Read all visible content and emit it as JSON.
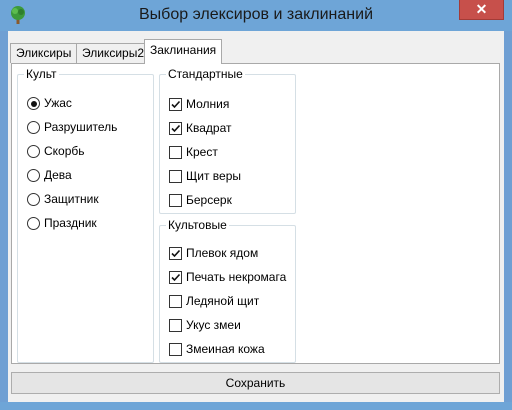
{
  "window": {
    "title": "Выбор элексиров и заклинаний",
    "close_symbol": "✕"
  },
  "tabs": [
    {
      "label": "Эликсиры",
      "active": false
    },
    {
      "label": "Эликсиры2",
      "active": false
    },
    {
      "label": "Заклинания",
      "active": true
    }
  ],
  "cult": {
    "legend": "Культ",
    "options": [
      {
        "label": "Ужас",
        "selected": true
      },
      {
        "label": "Разрушитель",
        "selected": false
      },
      {
        "label": "Скорбь",
        "selected": false
      },
      {
        "label": "Дева",
        "selected": false
      },
      {
        "label": "Защитник",
        "selected": false
      },
      {
        "label": "Праздник",
        "selected": false
      }
    ]
  },
  "standard": {
    "legend": "Стандартные",
    "items": [
      {
        "label": "Молния",
        "checked": true
      },
      {
        "label": "Квадрат",
        "checked": true
      },
      {
        "label": "Крест",
        "checked": false
      },
      {
        "label": "Щит веры",
        "checked": false
      },
      {
        "label": "Берсерк",
        "checked": false
      }
    ]
  },
  "cultish": {
    "legend": "Культовые",
    "items": [
      {
        "label": "Плевок ядом",
        "checked": true
      },
      {
        "label": "Печать некромага",
        "checked": true
      },
      {
        "label": "Ледяной щит",
        "checked": false
      },
      {
        "label": "Укус змеи",
        "checked": false
      },
      {
        "label": "Змеиная кожа",
        "checked": false
      }
    ]
  },
  "save_label": "Сохранить"
}
